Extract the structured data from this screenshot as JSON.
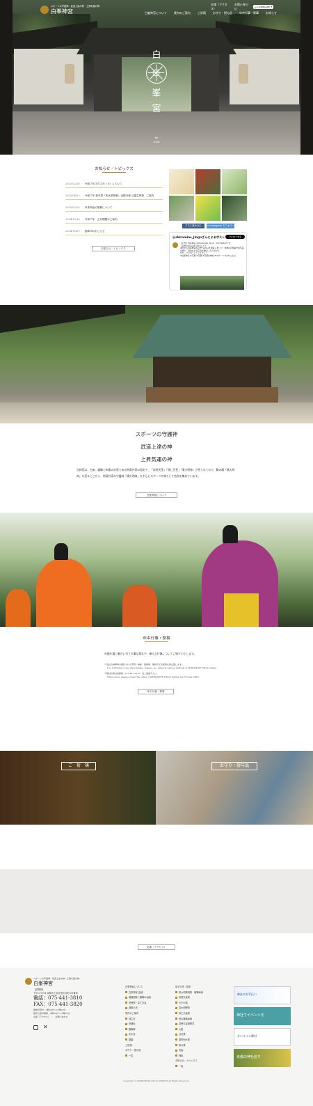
{
  "header": {
    "tagline": "スポーツの守護神・武道上達の神・上昇気運の神",
    "logo": "白峯神宮",
    "access_link": "交通（アクセス）",
    "contact_link": "お問い合わせ",
    "language": "Language",
    "nav": [
      "白峯神宮について",
      "境内のご案内",
      "ご祈祷",
      "お守り・授与品",
      "年中行事・祭事",
      "お知らせ"
    ]
  },
  "hero": {
    "seal_text": [
      "白",
      "峯",
      "宮"
    ],
    "scroll": "scroll"
  },
  "news": {
    "title": "お知らせ／トピックス",
    "items": [
      {
        "date": "2025/02/28",
        "text": "令和７年３月１日（土）について"
      },
      {
        "date": "2025/04/22",
        "text": "令和７年 新年祭「例大祭神事」近隣行事 公園主神事　ご案内"
      },
      {
        "date": "2025/02/20",
        "text": "年末年始の祭典について"
      },
      {
        "date": "2024/12/28",
        "text": "令和７年　正月期間のご案内"
      },
      {
        "date": "2024/10/09",
        "text": "御朱印のおしらせ"
      }
    ],
    "more": "お知らせ／トピックス"
  },
  "social": {
    "more_button": "さらに読み込む",
    "instagram_button": "Instagram でフォロー",
    "post_handle": "@shiramine_jinguさんによるポスト",
    "follow": "フォローする",
    "post_text": "【公式】白峯神宮 @shiramine_jingu · 2021年4月17日\n【公式Twitterはじめました】\n本日から白峯神宮の公式Twitterを開設しました！当神宮の祭事や授与品の紹介、境内などの写真を発信していきます。\nぜひ、フォローしてください♪\n#白峯神宮 #京都 #京都 #京都の神社 #スポーツ #みやこもも"
  },
  "about": {
    "lines": [
      "スポーツの守護神",
      "武道上達の神",
      "上昇気運の神"
    ],
    "body": "当神宮は、古来、蹴鞠と和歌の宗家である飛鳥井家の邸宅で、「崇徳天皇」「淳仁天皇」「清大明神」が祀られており、鞠の精「精大明神」を祀ることから、飛鳥井家の守護神「精大明神」を中心にスポーツの神として信仰を集めています。",
    "button": "白峯神宮について"
  },
  "events": {
    "title": "年中行事・祭事",
    "intro": "年間を通じ厳かに行う大事な祭礼や、様々な行事についてご紹介いたします。",
    "note1a": "※当社の神事等の撮影された写真・映像・画像等、無許可での使用を禁止致します。",
    "note1b": "It is forbidden to use photographs, images, etc. taken at various festivals of SHIRAMINE JINGU shrine.",
    "note2a": "※取材の際は社務所（075-441-3810）迄ご連絡下さい。",
    "note2b": "When using, please contact the office of SHIRAMINE JINGU Shrine (tel 075-441-3810)",
    "button": "年中行事・祭事"
  },
  "panels": {
    "kito": "ご　祈　祷",
    "omamori": "お守り・授与品"
  },
  "access_button": "交通（アクセス）",
  "footer": {
    "tagline": "スポーツの守護神・武道上達の神・上昇気運の神",
    "logo": "白峯神宮",
    "label": "【最寄駅】",
    "address": "〒602-0054 京都市上京区飛鳥井町261番地",
    "tel": "電話：075-441-3810",
    "fax": "FAX：075-441-3820",
    "hours1": "御朱印受付：9時00分〜17時00分",
    "hours2": "御守り授与時間：9時00分〜16時30分",
    "links": "交通（アクセス）　｜　お問い合わせ",
    "col1": [
      {
        "h": "白峯神宮について",
        "items": [
          "白峯神宮 由緒",
          "鎮護国家と蹴鞠の由緒",
          "崇徳院・淳仁天皇",
          "潜龍の池"
        ]
      },
      {
        "h": "境内のご案内",
        "items": [
          "地主社",
          "伴緒社",
          "蹴鞠碑",
          "手水舎",
          "蹴鞠"
        ]
      },
      {
        "h": "ご祈祷",
        "items": []
      },
      {
        "h": "お守り・授与品",
        "items": [
          "一覧"
        ]
      }
    ],
    "col2": [
      {
        "h": "年中行事・祭事",
        "items": [
          "精大明神例祭　蹴鞠奉納",
          "崇徳天皇祭",
          "七夕の儀",
          "精大明神祭",
          "淳仁天皇祭",
          "秋の蹴鞠奉納",
          "崇徳天皇御神忌",
          "大祓",
          "月次祭",
          "春季例大祭",
          "節分祭",
          "初詣",
          "神楽"
        ]
      },
      {
        "h": "お知らせ／トピックス",
        "items": [
          "一覧"
        ]
      }
    ],
    "ads": [
      "神社のお手伝い",
      "神社でイベントを",
      "オンライン寄付",
      "京都の神社巡り"
    ],
    "copyright": "Copyright © SHIRAMINE JINGU SHRINE All Rights Reserved."
  },
  "colors": {
    "gold": "#b58a2a",
    "gold_line": "#e4d28a",
    "footer_bg": "#f5f5f3",
    "gray_band": "#ecebea"
  },
  "icons": [
    "instagram-icon",
    "x-icon",
    "chevron-down-icon",
    "language-icon"
  ]
}
